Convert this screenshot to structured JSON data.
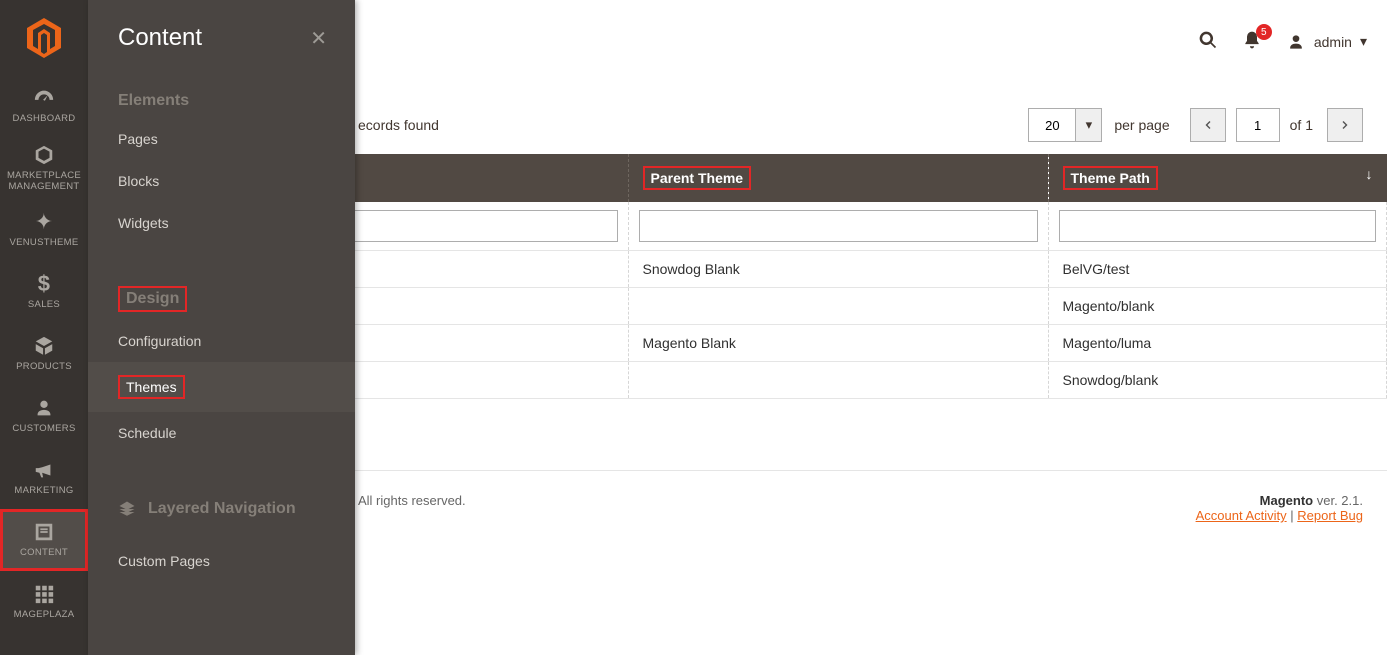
{
  "rail": {
    "items": [
      {
        "label": "DASHBOARD",
        "icon": "gauge"
      },
      {
        "label": "MARKETPLACE MANAGEMENT",
        "icon": "hex"
      },
      {
        "label": "VENUSTHEME",
        "icon": "spark"
      },
      {
        "label": "SALES",
        "icon": "dollar"
      },
      {
        "label": "PRODUCTS",
        "icon": "cube"
      },
      {
        "label": "CUSTOMERS",
        "icon": "user"
      },
      {
        "label": "MARKETING",
        "icon": "megaphone"
      },
      {
        "label": "CONTENT",
        "icon": "content"
      },
      {
        "label": "MAGEPLAZA",
        "icon": "grid"
      }
    ]
  },
  "flyout": {
    "title": "Content",
    "sections": {
      "elements": {
        "heading": "Elements",
        "items": [
          "Pages",
          "Blocks",
          "Widgets"
        ]
      },
      "design": {
        "heading": "Design",
        "items": [
          "Configuration",
          "Themes",
          "Schedule"
        ]
      },
      "lnav": {
        "heading": "Layered Navigation"
      },
      "custom": {
        "heading": "Custom Pages"
      }
    }
  },
  "topbar": {
    "notif_count": "5",
    "user": "admin"
  },
  "toolbar": {
    "records": "ecords found",
    "per_page_val": "20",
    "per_page_label": "per page",
    "page_val": "1",
    "of_label": "of 1"
  },
  "table": {
    "headers": {
      "c1": "",
      "c2": "Parent Theme",
      "c3": "Theme Path"
    },
    "rows": [
      {
        "c2": "Snowdog Blank",
        "c3": "BelVG/test"
      },
      {
        "c2": "",
        "c3": "Magento/blank"
      },
      {
        "c2": "Magento Blank",
        "c3": "Magento/luma"
      },
      {
        "c2": "",
        "c3": "Snowdog/blank"
      }
    ]
  },
  "footer": {
    "copy": "All rights reserved.",
    "brand": "Magento",
    "ver": " ver. 2.1.",
    "link1": "Account Activity",
    "sep": " | ",
    "link2": "Report Bug"
  }
}
